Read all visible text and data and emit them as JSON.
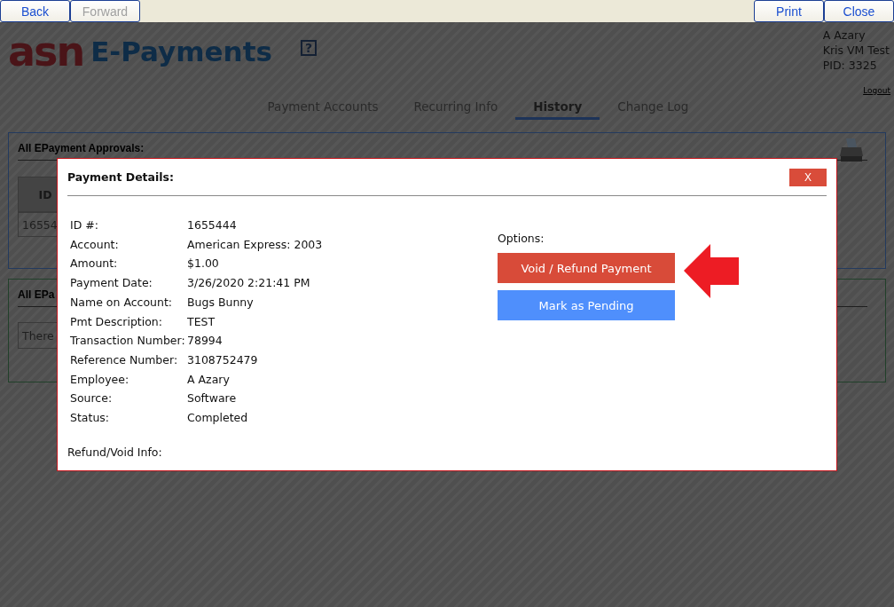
{
  "toolbar": {
    "left": [
      {
        "label": "Back",
        "disabled": false
      },
      {
        "label": "Forward",
        "disabled": true
      }
    ],
    "right": [
      {
        "label": "Print",
        "disabled": false
      },
      {
        "label": "Close",
        "disabled": false
      }
    ]
  },
  "header": {
    "logo_mark": "asn",
    "logo_text": "E-Payments",
    "help": "?",
    "user_lines": [
      "A Azary",
      "Kris VM Test",
      "PID: 3325"
    ],
    "logout": "Logout"
  },
  "tabs": [
    {
      "label": "Payment Accounts",
      "selected": false
    },
    {
      "label": "Recurring Info",
      "selected": false
    },
    {
      "label": "History",
      "selected": true
    },
    {
      "label": "Change Log",
      "selected": false
    }
  ],
  "approvals_panel": {
    "title": "All EPayment Approvals:",
    "column_1": "ID",
    "cell": "16554"
  },
  "second_panel": {
    "title": "All EPa",
    "message": "There"
  },
  "modal": {
    "title": "Payment Details:",
    "close": "X",
    "details": [
      {
        "label": "ID #:",
        "value": "1655444"
      },
      {
        "label": "Account:",
        "value": "American Express: 2003"
      },
      {
        "label": "Amount:",
        "value": "$1.00"
      },
      {
        "label": "Payment Date:",
        "value": "3/26/2020 2:21:41 PM"
      },
      {
        "label": "Name on Account:",
        "value": "Bugs Bunny"
      },
      {
        "label": "Pmt Description:",
        "value": "TEST"
      },
      {
        "label": "Transaction Number:",
        "value": "78994"
      },
      {
        "label": "Reference Number:",
        "value": "3108752479"
      },
      {
        "label": "Employee:",
        "value": "A Azary"
      },
      {
        "label": "Source:",
        "value": "Software"
      },
      {
        "label": "Status:",
        "value": "Completed"
      }
    ],
    "refund_label": "Refund/Void Info:",
    "options_label": "Options:",
    "options": [
      {
        "label": "Void / Refund Payment",
        "kind": "danger"
      },
      {
        "label": "Mark as Pending",
        "kind": "primary"
      }
    ]
  }
}
